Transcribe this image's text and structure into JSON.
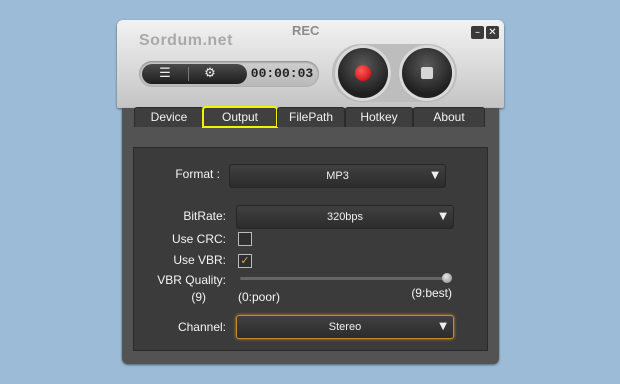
{
  "window": {
    "app_title": "Sordum.net",
    "rec_label": "REC",
    "minimize_glyph": "–",
    "close_glyph": "✕"
  },
  "toolbar": {
    "list_icon_glyph": "☰",
    "settings_icon_glyph": "⚙",
    "timer": "00:00:03"
  },
  "controls": {
    "record_icon": "record-icon",
    "stop_icon": "stop-icon"
  },
  "tabs": [
    {
      "label": "Device",
      "active": false
    },
    {
      "label": "Output",
      "active": true
    },
    {
      "label": "FilePath",
      "active": false
    },
    {
      "label": "Hotkey",
      "active": false
    },
    {
      "label": "About",
      "active": false
    }
  ],
  "output": {
    "format_label": "Format :",
    "format_value": "MP3",
    "bitrate_label": "BitRate:",
    "bitrate_value": "320bps",
    "use_crc_label": "Use CRC:",
    "use_crc_checked": false,
    "use_vbr_label": "Use VBR:",
    "use_vbr_checked": true,
    "use_vbr_mark": "✓",
    "vbr_quality_label": "VBR Quality:",
    "vbr_quality_value": "(9)",
    "vbr_quality_level": 9,
    "vbr_min_label": "(0:poor)",
    "vbr_max_label": "(9:best)",
    "channel_label": "Channel:",
    "channel_value": "Stereo",
    "chevron_glyph": "▼"
  },
  "colors": {
    "accent_focus": "#c98b2a",
    "active_tab_outline": "#f3f300",
    "record_red": "#c00000",
    "background": "#9bbbd6"
  }
}
